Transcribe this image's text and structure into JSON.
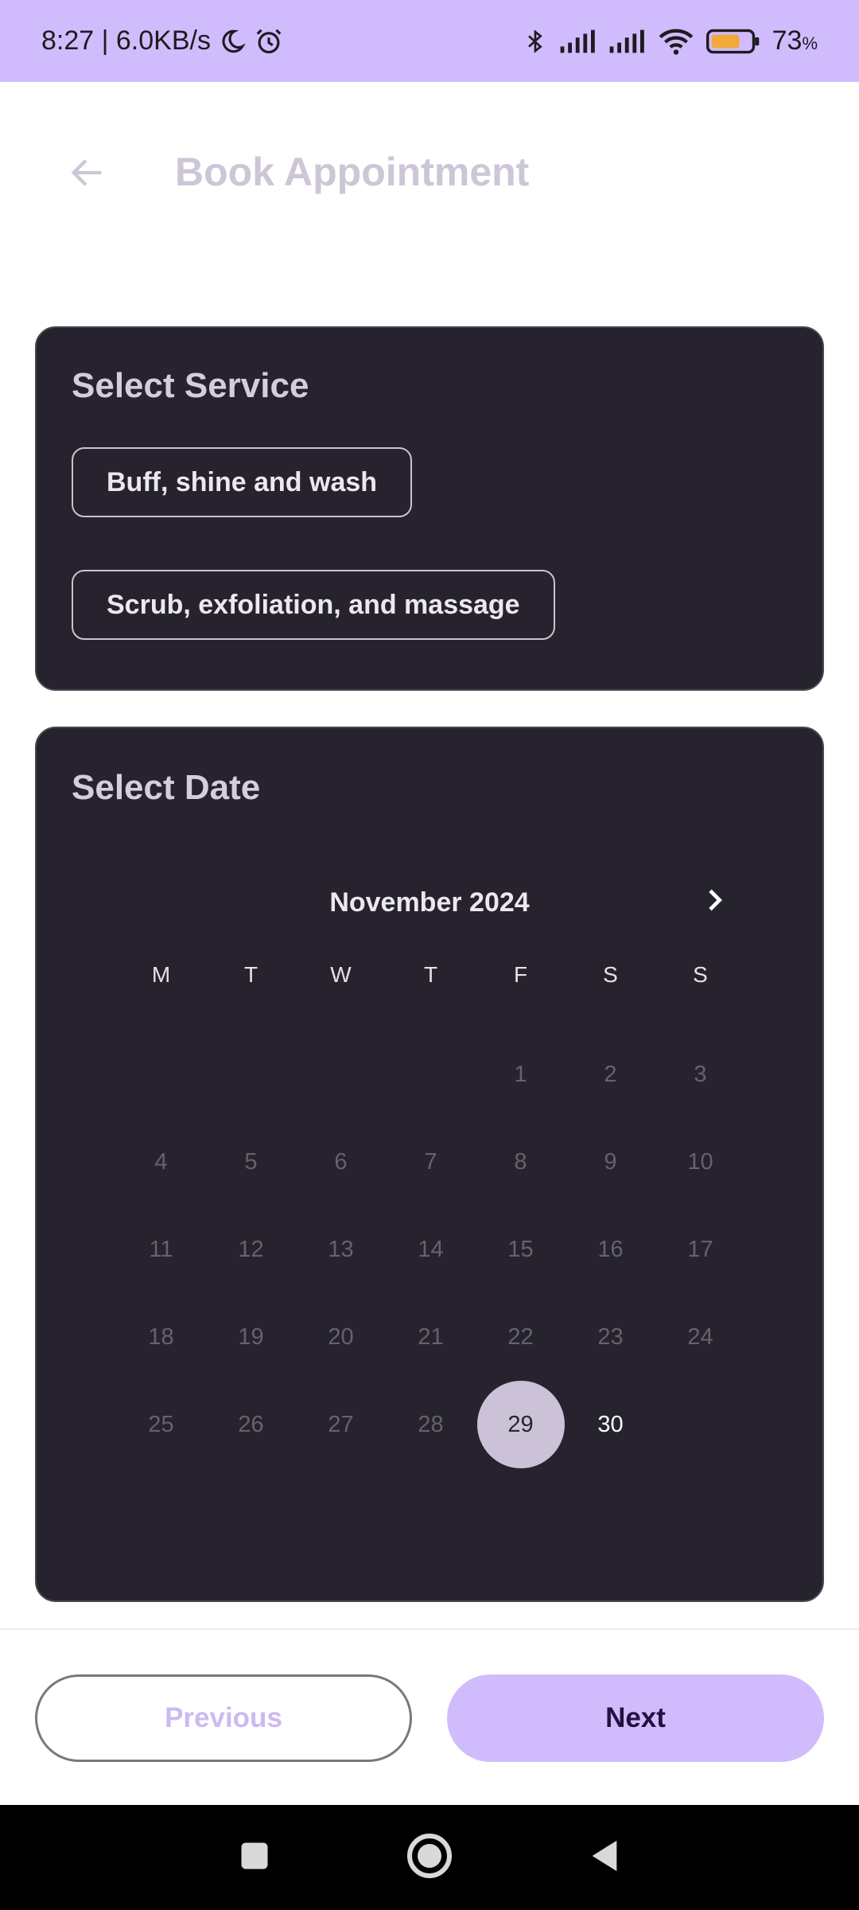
{
  "status_bar": {
    "time_speed": "8:27 | 6.0KB/s",
    "battery_percent": "73",
    "battery_unit": "%",
    "battery_level": 0.73,
    "icons": [
      "moon-icon",
      "alarm-icon",
      "bluetooth-icon",
      "signal-icon",
      "signal-icon",
      "wifi-icon",
      "battery-icon"
    ]
  },
  "header": {
    "title": "Book Appointment",
    "back_icon": "arrow-left-icon"
  },
  "service_section": {
    "title": "Select Service",
    "options": [
      "Buff, shine and wash",
      "Scrub, exfoliation, and massage"
    ]
  },
  "date_section": {
    "title": "Select Date",
    "month_label": "November 2024",
    "next_icon": "chevron-right-icon",
    "weekdays": [
      "M",
      "T",
      "W",
      "T",
      "F",
      "S",
      "S"
    ],
    "leading_blank_days": 4,
    "days": [
      "1",
      "2",
      "3",
      "4",
      "5",
      "6",
      "7",
      "8",
      "9",
      "10",
      "11",
      "12",
      "13",
      "14",
      "15",
      "16",
      "17",
      "18",
      "19",
      "20",
      "21",
      "22",
      "23",
      "24",
      "25",
      "26",
      "27",
      "28",
      "29",
      "30"
    ],
    "selected_day": "29",
    "available_days": [
      "29",
      "30"
    ]
  },
  "actions": {
    "previous_label": "Previous",
    "next_label": "Next"
  },
  "colors": {
    "accent": "#d0bcfc",
    "card_bg": "#26232e",
    "selected_day_bg": "#ccc2d8"
  }
}
